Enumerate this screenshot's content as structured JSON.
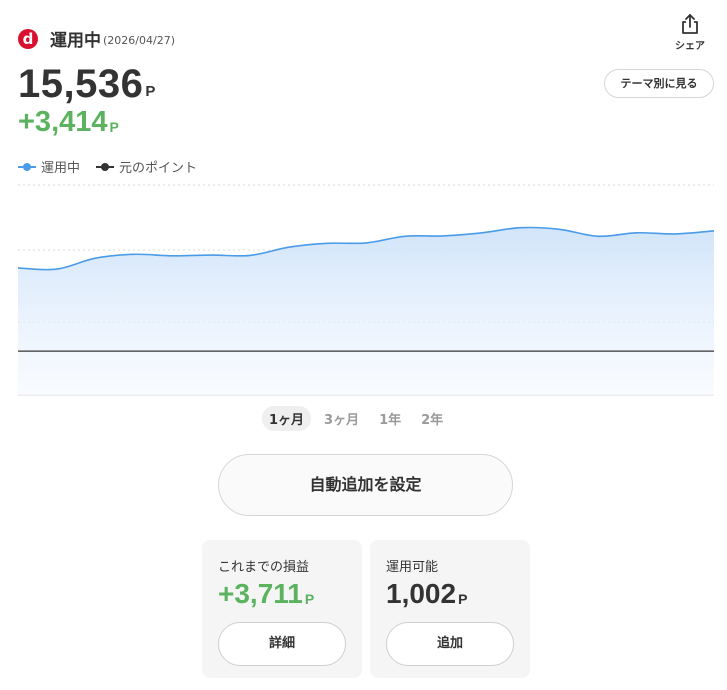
{
  "header": {
    "logo_letter": "d",
    "title": "運用中",
    "date": "(2026/04/27)"
  },
  "share": {
    "label": "シェア",
    "icon": "share-icon"
  },
  "theme_button": {
    "label": "テーマ別に見る"
  },
  "balance": {
    "value": "15,536",
    "unit": "P"
  },
  "gain": {
    "value": "+3,414",
    "unit": "P"
  },
  "legend": [
    {
      "label": "運用中",
      "color": "#4a9be8"
    },
    {
      "label": "元のポイント",
      "color": "#333333"
    }
  ],
  "chart_data": {
    "type": "area",
    "title": "",
    "xlabel": "",
    "ylabel": "",
    "ylim": [
      11000,
      16500
    ],
    "grid": true,
    "series": [
      {
        "name": "運用中",
        "color": "#4a9be8",
        "values": [
          14250,
          14220,
          14500,
          14600,
          14560,
          14580,
          14570,
          14780,
          14880,
          14890,
          15060,
          15070,
          15150,
          15280,
          15240,
          15060,
          15150,
          15120,
          15200
        ]
      },
      {
        "name": "元のポイント",
        "color": "#333333",
        "values": [
          12122,
          12122,
          12122,
          12122,
          12122,
          12122,
          12122,
          12122,
          12122,
          12122,
          12122,
          12122,
          12122,
          12122,
          12122,
          12122,
          12122,
          12122,
          12122
        ]
      }
    ]
  },
  "periods": [
    {
      "label": "1ヶ月",
      "active": true
    },
    {
      "label": "3ヶ月",
      "active": false
    },
    {
      "label": "1年",
      "active": false
    },
    {
      "label": "2年",
      "active": false
    }
  ],
  "auto_button": {
    "label": "自動追加を設定"
  },
  "cards": [
    {
      "title": "これまでの損益",
      "value": "+3,711",
      "unit": "P",
      "button": "詳細",
      "value_color": "green"
    },
    {
      "title": "運用可能",
      "value": "1,002",
      "unit": "P",
      "button": "追加",
      "value_color": "dark"
    }
  ]
}
